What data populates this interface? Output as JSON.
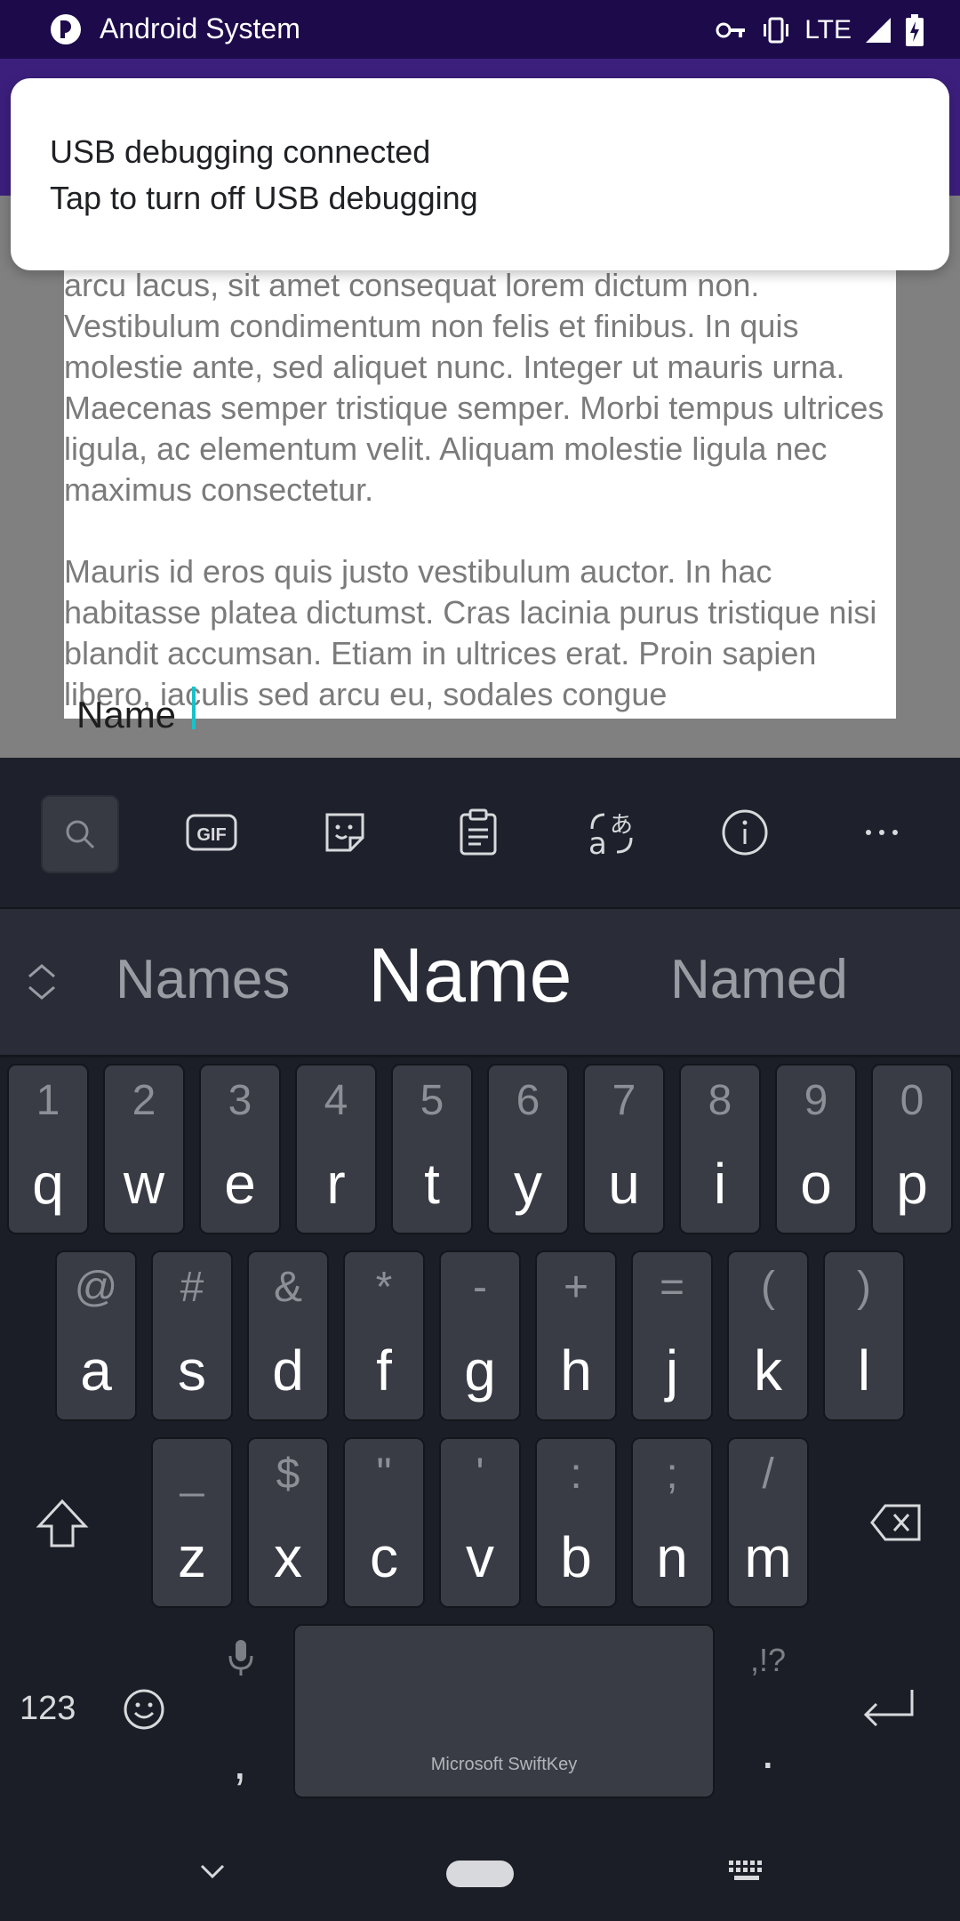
{
  "status_bar": {
    "title": "Android System",
    "network": "LTE"
  },
  "notification": {
    "title": "USB debugging connected",
    "text": "Tap to turn off USB debugging"
  },
  "document": {
    "paragraphs": [
      "arcu lacus, sit amet consequat lorem dictum non. Vestibulum condimentum non felis et finibus. In quis molestie ante, sed aliquet nunc. Integer ut mauris urna. Maecenas semper tristique semper. Morbi tempus ultrices ligula, ac elementum velit. Aliquam molestie ligula nec maximus consectetur.",
      "Mauris id eros quis justo vestibulum auctor. In hac habitasse platea dictumst. Cras lacinia purus tristique nisi blandit accumsan. Etiam in ultrices erat. Proin sapien libero, iaculis sed arcu eu, sodales congue"
    ],
    "typed_text": "Name"
  },
  "keyboard": {
    "toolbar_icons": [
      "search-icon",
      "gif-icon",
      "sticker-icon",
      "clipboard-icon",
      "translate-icon",
      "info-icon",
      "more-icon"
    ],
    "suggestions": {
      "left": "Names",
      "center": "Name",
      "right": "Named"
    },
    "row1": [
      {
        "alt": "1",
        "key": "q"
      },
      {
        "alt": "2",
        "key": "w"
      },
      {
        "alt": "3",
        "key": "e"
      },
      {
        "alt": "4",
        "key": "r"
      },
      {
        "alt": "5",
        "key": "t"
      },
      {
        "alt": "6",
        "key": "y"
      },
      {
        "alt": "7",
        "key": "u"
      },
      {
        "alt": "8",
        "key": "i"
      },
      {
        "alt": "9",
        "key": "o"
      },
      {
        "alt": "0",
        "key": "p"
      }
    ],
    "row2": [
      {
        "alt": "@",
        "key": "a"
      },
      {
        "alt": "#",
        "key": "s"
      },
      {
        "alt": "&",
        "key": "d"
      },
      {
        "alt": "*",
        "key": "f"
      },
      {
        "alt": "-",
        "key": "g"
      },
      {
        "alt": "+",
        "key": "h"
      },
      {
        "alt": "=",
        "key": "j"
      },
      {
        "alt": "(",
        "key": "k"
      },
      {
        "alt": ")",
        "key": "l"
      }
    ],
    "row3": [
      {
        "alt": "_",
        "key": "z"
      },
      {
        "alt": "$",
        "key": "x"
      },
      {
        "alt": "\"",
        "key": "c"
      },
      {
        "alt": "'",
        "key": "v"
      },
      {
        "alt": ":",
        "key": "b"
      },
      {
        "alt": ";",
        "key": "n"
      },
      {
        "alt": "/",
        "key": "m"
      }
    ],
    "numbers_label": "123",
    "comma": ",",
    "period": ".",
    "period_alt": ",!?",
    "space_label": "Microsoft SwiftKey"
  }
}
